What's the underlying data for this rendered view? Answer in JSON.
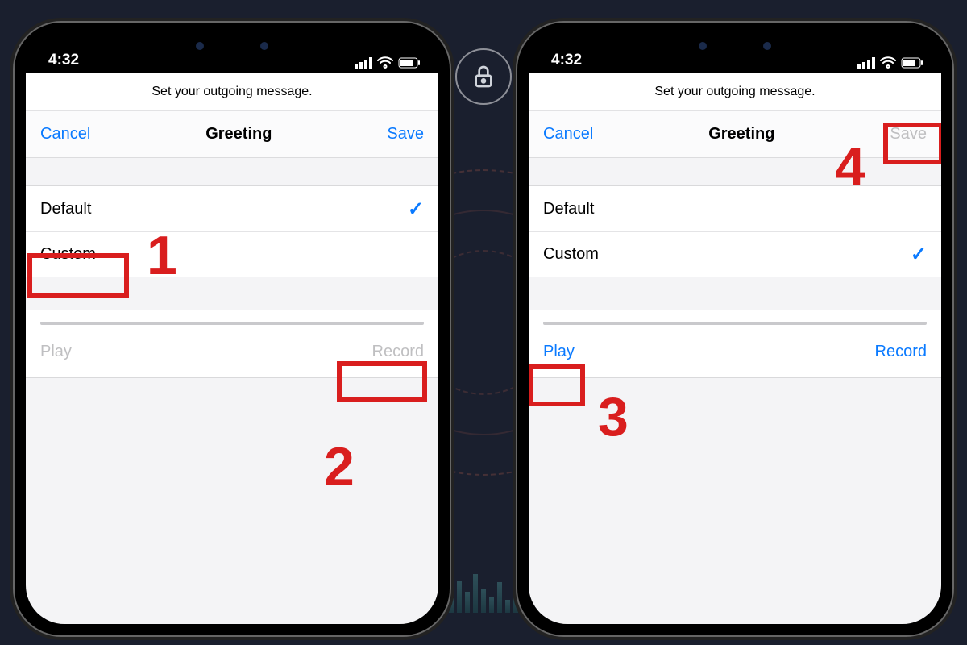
{
  "status": {
    "time": "4:32"
  },
  "subtitle": "Set your outgoing message.",
  "nav": {
    "cancel": "Cancel",
    "title": "Greeting",
    "save": "Save"
  },
  "options": {
    "default": "Default",
    "custom": "Custom"
  },
  "controls": {
    "play": "Play",
    "record": "Record"
  },
  "annotations": {
    "n1": "1",
    "n2": "2",
    "n3": "3",
    "n4": "4"
  },
  "phone_left": {
    "selected": "default",
    "play_enabled": false,
    "record_enabled": false,
    "save_enabled": true
  },
  "phone_right": {
    "selected": "custom",
    "play_enabled": true,
    "record_enabled": true,
    "save_enabled": false
  }
}
